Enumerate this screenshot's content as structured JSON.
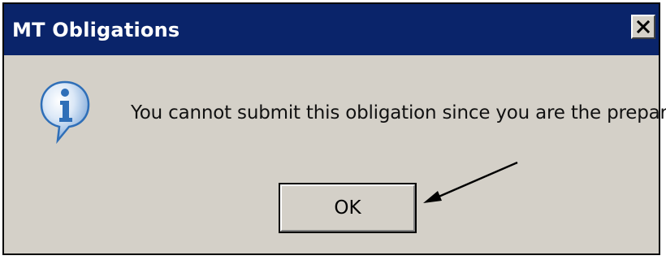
{
  "dialog": {
    "title": "MT Obligations",
    "close_label": "Close",
    "icon": "information-icon",
    "message": "You cannot submit this obligation since you are the preparer",
    "ok_label": "OK"
  },
  "annotation": {
    "arrow_icon": "arrow-icon"
  },
  "colors": {
    "titlebar": "#0a246a",
    "title_text": "#ffffff",
    "dialog_background": "#d4d0c8",
    "icon_blue": "#2f6fb8"
  }
}
